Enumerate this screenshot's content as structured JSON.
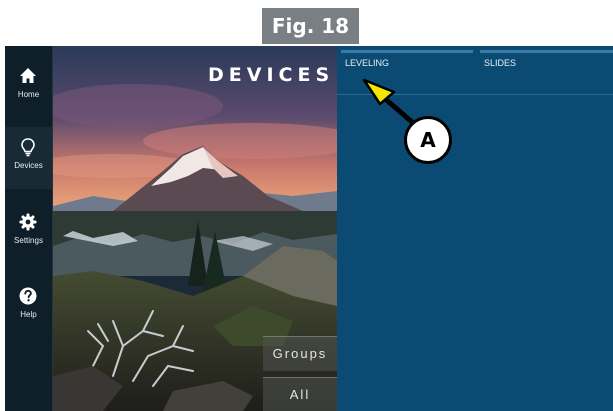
{
  "figure": {
    "label": "Fig. 18"
  },
  "sidebar": {
    "items": [
      {
        "label": "Home",
        "icon": "home-icon"
      },
      {
        "label": "Devices",
        "icon": "lightbulb-icon"
      },
      {
        "label": "Settings",
        "icon": "gear-icon"
      },
      {
        "label": "Help",
        "icon": "help-icon"
      }
    ]
  },
  "hero": {
    "title": "DEVICES",
    "groups_label": "Groups",
    "all_label": "All"
  },
  "tabs": [
    {
      "label": "LEVELING"
    },
    {
      "label": "SLIDES"
    }
  ],
  "callout": {
    "label": "A",
    "arrow_color": "#f2e600"
  },
  "colors": {
    "content_bg": "#0b4a72",
    "sidebar_bg": "#0e1f2a",
    "figure_label_bg": "#7a7f83"
  }
}
